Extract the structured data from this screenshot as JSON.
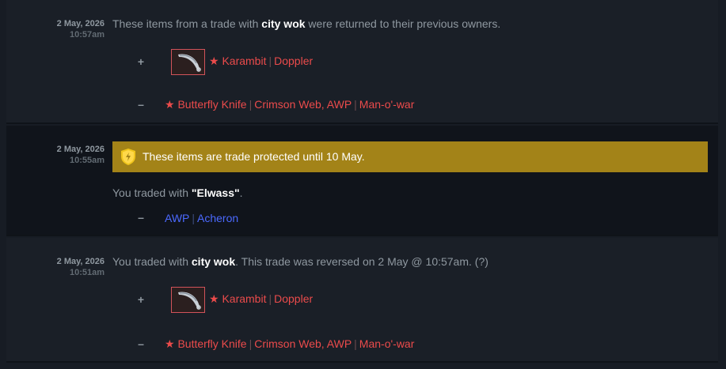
{
  "colors": {
    "covert_red": "#eb4b4b",
    "milspec_blue": "#4b69ff",
    "banner_gold": "#a38318"
  },
  "entries": [
    {
      "date": "2 May, 2026",
      "time": "10:57am",
      "desc_pre": "These items from a trade with ",
      "desc_name": "city wok",
      "desc_post": " were returned to their previous owners.",
      "received_sign": "+",
      "received": {
        "star": "★ Karambit",
        "skin": "Doppler",
        "icon": "karambit-icon"
      },
      "given_sign": "–",
      "given": [
        "★ Butterfly Knife",
        "Crimson Web, AWP",
        "Man-o'-war"
      ]
    },
    {
      "date": "2 May, 2026",
      "time": "10:55am",
      "banner": "These items are trade protected until 10 May.",
      "banner_icon": "shield-icon",
      "desc_pre": "You traded with ",
      "desc_name": "\"Elwass\"",
      "desc_post": ".",
      "given_sign": "–",
      "given": [
        "AWP",
        "Acheron"
      ]
    },
    {
      "date": "2 May, 2026",
      "time": "10:51am",
      "desc_pre": "You traded with ",
      "desc_name": "city wok",
      "desc_post": ". This trade was reversed on 2 May @ 10:57am. (?)",
      "received_sign": "+",
      "received": {
        "star": "★ Karambit",
        "skin": "Doppler",
        "icon": "karambit-icon"
      },
      "given_sign": "–",
      "given": [
        "★ Butterfly Knife",
        "Crimson Web, AWP",
        "Man-o'-war"
      ]
    }
  ]
}
